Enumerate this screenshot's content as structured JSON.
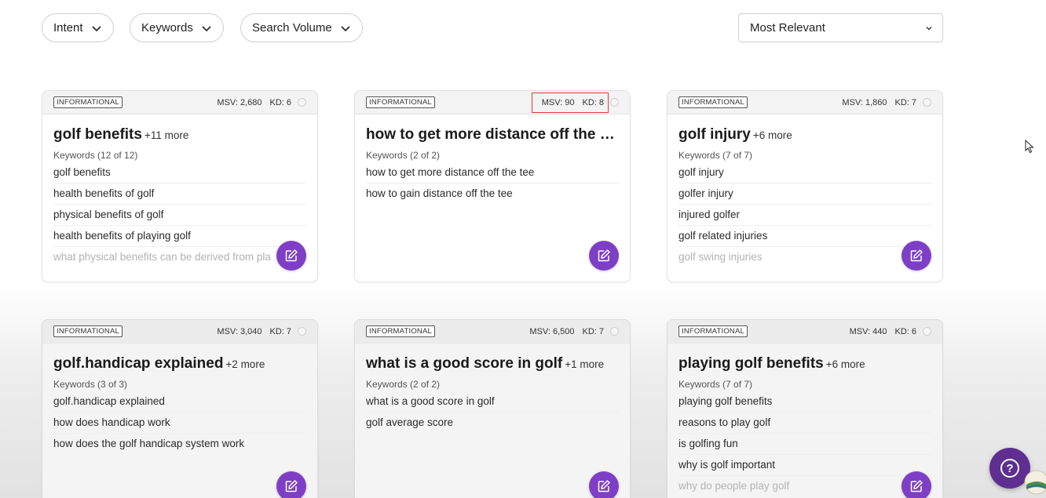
{
  "filters": {
    "pills": [
      {
        "label": "Intent"
      },
      {
        "label": "Keywords"
      },
      {
        "label": "Search Volume"
      }
    ],
    "sort_value": "Most Relevant"
  },
  "cards": [
    {
      "badge": "INFORMATIONAL",
      "msv": "MSV: 2,680",
      "kd": "KD: 6",
      "title": "golf benefits",
      "more": "+11 more",
      "keywords_label": "Keywords (12 of 12)",
      "keywords": [
        "golf benefits",
        "health benefits of golf",
        "physical benefits of golf",
        "health benefits of playing golf",
        "what physical benefits can be derived from pla"
      ]
    },
    {
      "badge": "INFORMATIONAL",
      "msv": "MSV: 90",
      "kd": "KD: 8",
      "title": "how to get more distance off the te...",
      "more": "",
      "keywords_label": "Keywords (2 of 2)",
      "keywords": [
        "how to get more distance off the tee",
        "how to gain distance off the tee"
      ]
    },
    {
      "badge": "INFORMATIONAL",
      "msv": "MSV: 1,860",
      "kd": "KD: 7",
      "title": "golf injury",
      "more": "+6 more",
      "keywords_label": "Keywords (7 of 7)",
      "keywords": [
        "golf injury",
        "golfer injury",
        "injured golfer",
        "golf related injuries",
        "golf swing injuries"
      ]
    },
    {
      "badge": "INFORMATIONAL",
      "msv": "MSV: 3,040",
      "kd": "KD: 7",
      "title": "golf.handicap explained",
      "more": "+2 more",
      "keywords_label": "Keywords (3 of 3)",
      "keywords": [
        "golf.handicap explained",
        "how does handicap work",
        "how does the golf handicap system work"
      ]
    },
    {
      "badge": "INFORMATIONAL",
      "msv": "MSV: 6,500",
      "kd": "KD: 7",
      "title": "what is a good score in golf",
      "more": "+1 more",
      "keywords_label": "Keywords (2 of 2)",
      "keywords": [
        "what is a good score in golf",
        "golf average score"
      ]
    },
    {
      "badge": "INFORMATIONAL",
      "msv": "MSV: 440",
      "kd": "KD: 6",
      "title": "playing golf benefits",
      "more": "+6 more",
      "keywords_label": "Keywords (7 of 7)",
      "keywords": [
        "playing golf benefits",
        "reasons to play golf",
        "is golfing fun",
        "why is golf important",
        "why do people play golf"
      ]
    }
  ],
  "help_label": "?",
  "colors": {
    "accent": "#7e3fc6",
    "help": "#5e2e91",
    "highlight": "#e53935"
  },
  "icons": [
    "chevron-down-icon",
    "edit-icon",
    "help-icon",
    "cursor-icon"
  ]
}
